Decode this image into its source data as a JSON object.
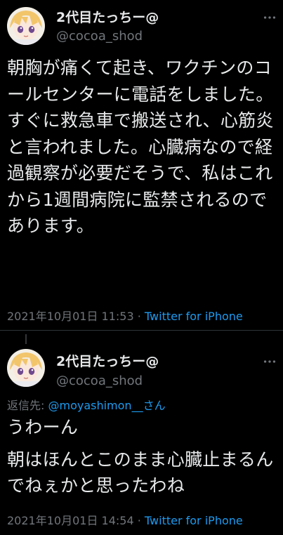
{
  "colors": {
    "background": "#000000",
    "text": "#e7e9ea",
    "muted": "#71767b",
    "link": "#1d9bf0",
    "divider": "#2f3336"
  },
  "tweets": [
    {
      "author": {
        "display_name": "2代目たっちー@",
        "handle": "@cocoa_shod",
        "avatar_icon": "anime-avatar-icon"
      },
      "text": "朝胸が痛くて起き、ワクチンのコールセンターに電話をしました。すぐに救急車で搬送され、心筋炎と言われました。心臓病なので経過観察が必要だそうで、私はこれから1週間病院に監禁されるのであります。",
      "timestamp": "2021年10月01日 11:53",
      "separator": "·",
      "source": "Twitter for iPhone"
    },
    {
      "author": {
        "display_name": "2代目たっちー@",
        "handle": "@cocoa_shod",
        "avatar_icon": "anime-avatar-icon"
      },
      "reply_prefix": "返信先: ",
      "reply_target": "@moyashimon__さん",
      "text_lines": [
        "うわーん",
        "朝はほんとこのまま心臓止まるんでねぇかと思ったわね"
      ],
      "timestamp": "2021年10月01日 14:54",
      "separator": "·",
      "source": "Twitter for iPhone"
    }
  ]
}
